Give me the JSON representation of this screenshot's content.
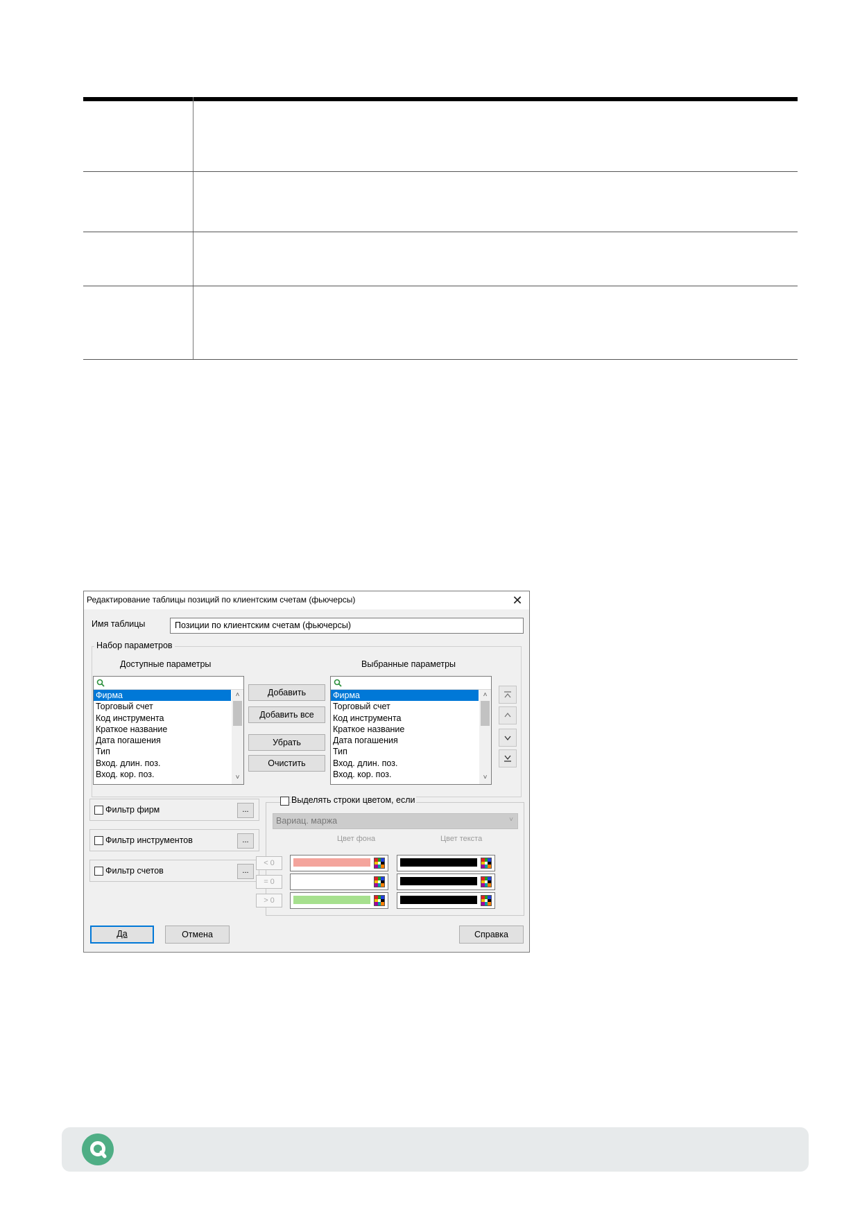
{
  "dialog": {
    "title": "Редактирование таблицы позиций по клиентским счетам (фьючерсы)",
    "close_glyph": "✕",
    "table_name_label": "Имя таблицы",
    "table_name_value": "Позиции по клиентским счетам (фьючерсы)",
    "param_group_label": "Набор параметров",
    "available_label": "Доступные параметры",
    "selected_label": "Выбранные параметры",
    "available_items": [
      "Фирма",
      "Торговый счет",
      "Код инструмента",
      "Краткое название",
      "Дата погашения",
      "Тип",
      "Вход. длин. поз.",
      "Вход. кор. поз."
    ],
    "selected_items": [
      "Фирма",
      "Торговый счет",
      "Код инструмента",
      "Краткое название",
      "Дата погашения",
      "Тип",
      "Вход. длин. поз.",
      "Вход. кор. поз."
    ],
    "buttons": {
      "add": "Добавить",
      "add_all": "Добавить все",
      "remove": "Убрать",
      "clear": "Очистить"
    },
    "filters": {
      "firms": "Фильтр фирм",
      "instruments": "Фильтр инструментов",
      "accounts": "Фильтр счетов",
      "dots": "..."
    },
    "highlight": {
      "checkbox_label": "Выделять строки цветом, если",
      "combo_value": "Вариац. маржа",
      "bg_caption": "Цвет фона",
      "text_caption": "Цвет текста",
      "rows": [
        {
          "cmp": "< 0",
          "bg": "#f4a49c",
          "fg": "#000000"
        },
        {
          "cmp": "= 0",
          "bg": "#ffffff",
          "fg": "#000000"
        },
        {
          "cmp": "> 0",
          "bg": "#a6e08e",
          "fg": "#000000"
        }
      ]
    },
    "footer_buttons": {
      "ok": "Да",
      "cancel": "Отмена",
      "help": "Справка"
    }
  },
  "colors": {
    "selection": "#0078d7",
    "footer_bg": "#e7eaeb",
    "logo": "#4fae85"
  }
}
